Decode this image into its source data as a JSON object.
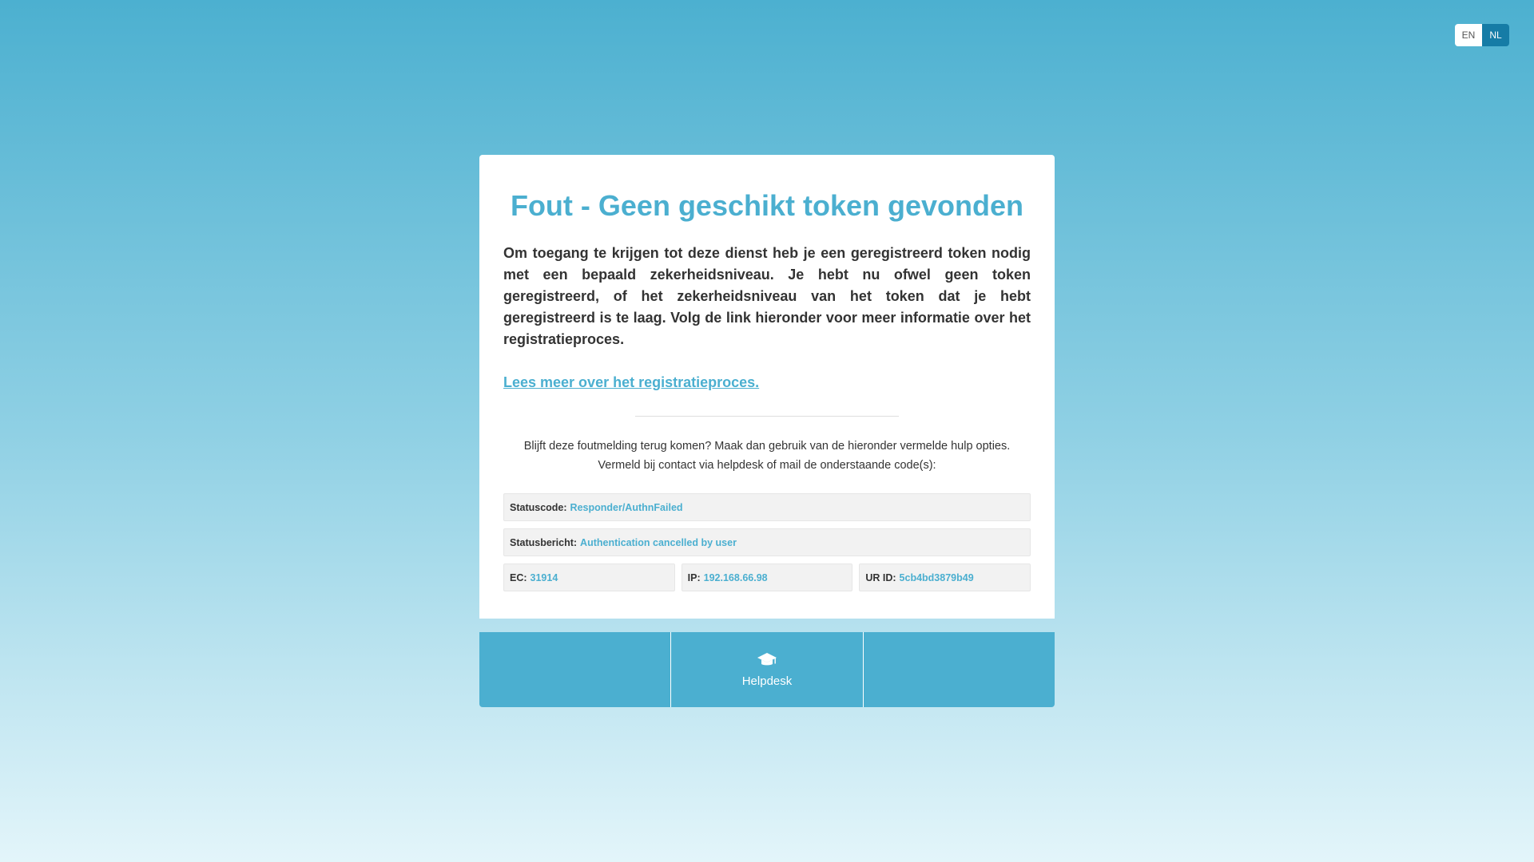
{
  "lang": {
    "en_label": "EN",
    "nl_label": "NL"
  },
  "error": {
    "title": "Fout - Geen geschikt token gevonden",
    "description": "Om toegang te krijgen tot deze dienst heb je een geregistreerd token nodig met een bepaald zekerheidsniveau. Je hebt nu ofwel geen token geregistreerd, of het zekerheidsniveau van het token dat je hebt geregistreerd is te laag. Volg de link hieronder voor meer informatie over het registratieproces.",
    "link_text": "Lees meer over het registratieproces."
  },
  "help": {
    "line1": "Blijft deze foutmelding terug komen? Maak dan gebruik van de hieronder vermelde hulp opties.",
    "line2": "Vermeld bij contact via helpdesk of mail de onderstaande code(s):"
  },
  "codes": {
    "status_code_label": "Statuscode:",
    "status_code_value": "Responder/AuthnFailed",
    "status_message_label": "Statusbericht:",
    "status_message_value": "Authentication cancelled by user",
    "ec_label": "EC:",
    "ec_value": "31914",
    "ip_label": "IP:",
    "ip_value": "192.168.66.98",
    "urid_label": "UR ID:",
    "urid_value": "5cb4bd3879b49"
  },
  "footer": {
    "helpdesk_label": "Helpdesk",
    "helpdesk_icon": "graduation-cap-icon"
  },
  "colors": {
    "accent": "#4bafd0",
    "lang_active": "#167ca6"
  }
}
